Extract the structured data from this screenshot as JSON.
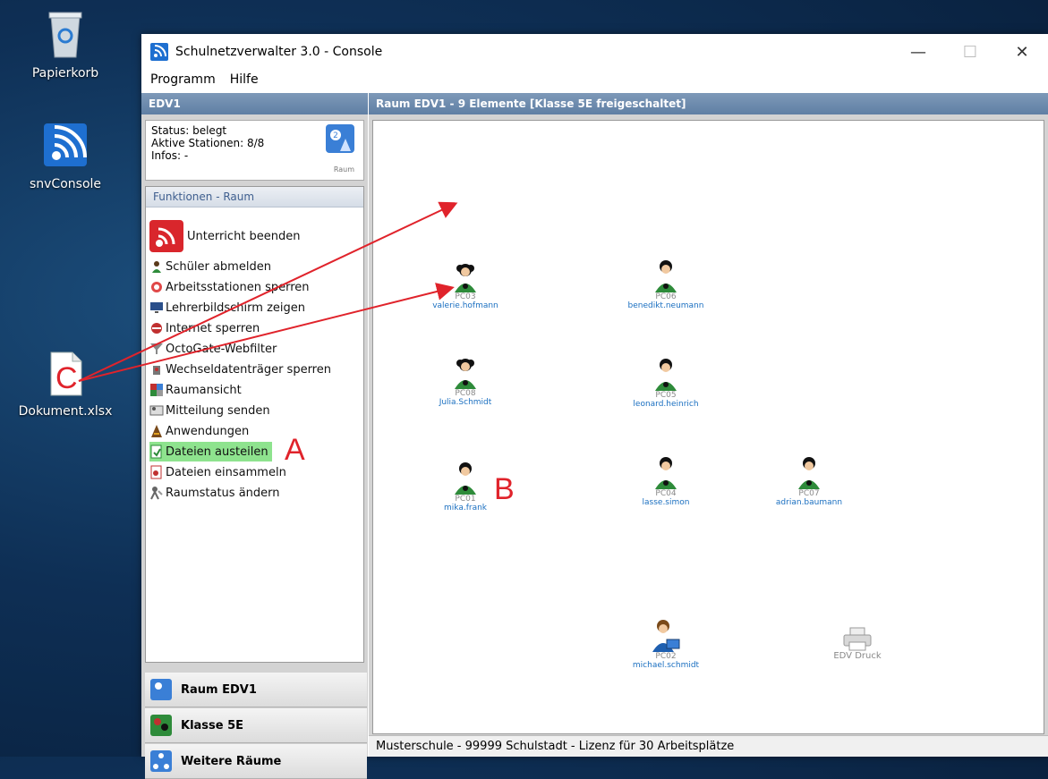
{
  "desktop": {
    "icons": [
      {
        "label": "Papierkorb"
      },
      {
        "label": "snvConsole"
      },
      {
        "label": "Dokument.xlsx"
      }
    ]
  },
  "window": {
    "title": "Schulnetzverwalter 3.0 - Console",
    "menu": [
      "Programm",
      "Hilfe"
    ]
  },
  "left_pane": {
    "header": "EDV1",
    "status": {
      "status_line": "Status: belegt",
      "stations_line": "Aktive Stationen: 8/8",
      "infos_line": "Infos: -",
      "icon_caption": "Raum"
    },
    "functions_header": "Funktionen - Raum",
    "functions": [
      "Unterricht beenden",
      "Schüler abmelden",
      "Arbeitsstationen sperren",
      "Lehrerbildschirm zeigen",
      "Internet sperren",
      "OctoGate-Webfilter",
      "Wechseldatenträger sperren",
      "Raumansicht",
      "Mitteilung senden",
      "Anwendungen",
      "Dateien austeilen",
      "Dateien einsammeln",
      "Raumstatus ändern"
    ],
    "nav": [
      "Raum EDV1",
      "Klasse 5E",
      "Weitere Räume"
    ]
  },
  "right_pane": {
    "header": "Raum EDV1 - 9 Elemente [Klasse 5E freigeschaltet]",
    "stations": [
      {
        "pc": "PC03",
        "user": "valerie.hofmann",
        "kind": "student-female"
      },
      {
        "pc": "PC06",
        "user": "benedikt.neumann",
        "kind": "student"
      },
      {
        "pc": "PC08",
        "user": "Julia.Schmidt",
        "kind": "student-female"
      },
      {
        "pc": "PC05",
        "user": "leonard.heinrich",
        "kind": "student"
      },
      {
        "pc": "PC01",
        "user": "mika.frank",
        "kind": "student"
      },
      {
        "pc": "PC04",
        "user": "lasse.simon",
        "kind": "student"
      },
      {
        "pc": "PC07",
        "user": "adrian.baumann",
        "kind": "student"
      },
      {
        "pc": "PC02",
        "user": "michael.schmidt",
        "kind": "teacher"
      },
      {
        "pc": "",
        "user": "EDV Druck",
        "kind": "printer"
      }
    ],
    "statusbar": "Musterschule - 99999 Schulstadt - Lizenz für 30 Arbeitsplätze"
  },
  "annotations": {
    "a": "A",
    "b": "B",
    "c": "C"
  },
  "colors": {
    "arrow": "#e0232b",
    "highlight": "#8ee38e",
    "station_green": "#2e8b3a",
    "link": "#1a6fc0"
  }
}
